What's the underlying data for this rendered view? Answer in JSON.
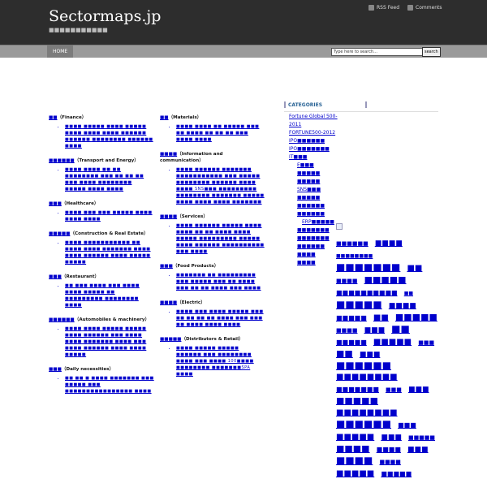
{
  "header": {
    "site_title": "Sectormaps.jp",
    "site_description": "■■■■■■■■■■■",
    "rss_label": "RSS Feed",
    "comments_label": "Comments",
    "rss_icon": "rss-icon",
    "comments_icon": "comment-feed-icon"
  },
  "nav": {
    "home_label": "HOME",
    "search_placeholder": "Type here to search...",
    "search_button": "search"
  },
  "categories_left": [
    {
      "title_link": "■■",
      "title": "Finance",
      "items": [
        "■■■■ ■■■■■ ■■■■ ■■■■■ ■■■■ ■■■■ ■■■■ ■■■■■■ ■■■■■■ ■■■■■■■■ ■■■■■■ ■■■■"
      ]
    },
    {
      "title_link": "■■■■■■",
      "title": "Transport and Energy",
      "items": [
        "■■■■ ■■■■ ■■ ■■ ■■■■■■■■ ■■■ ■■ ■■ ■■ ■■■ ■■■■ ■■■■■■■■ ■■■■■ ■■■■ ■■■■"
      ]
    },
    {
      "title_link": "■■■",
      "title": "Healthcare",
      "items": [
        "■■■■ ■■■ ■■■ ■■■■■ ■■■■ ■■■■ ■■■■"
      ]
    },
    {
      "title_link": "■■■■■",
      "title": "Construction & Real Estate",
      "items": [
        "■■■■ ■■■■■■■■■■■ ■■ ■■■■ ■■■■ ■■■■■■■ ■■■■ ■■■■ ■■■■■■ ■■■■ ■■■■■ ■■■■■"
      ]
    },
    {
      "title_link": "■■■",
      "title": "Restaurant",
      "items": [
        "■■ ■■■ ■■■■ ■■■ ■■■■ ■■■■ ■■■■■ ■■ ■■■■■■■■■ ■■■■■■■■ ■■■■"
      ]
    },
    {
      "title_link": "■■■■■■",
      "title": "Automobiles & machinery",
      "items": [
        "■■■■ ■■■■ ■■■■■ ■■■■■ ■■■■ ■■■■■■ ■■■ ■■■■ ■■■■ ■■■■■■■ ■■■■ ■■■ ■■■■ ■■■■■■ ■■■■ ■■■■ ■■■■■"
      ]
    },
    {
      "title_link": "■■■",
      "title": "Daily necessities",
      "items": [
        "■■ ■■ ■ ■■■■ ■■■■■■■ ■■■ ■■■■■ ■■■ ■■■■■■■■■■■■■■■■ ■■■■"
      ]
    }
  ],
  "categories_right": [
    {
      "title_link": "■■",
      "title": "Materials",
      "items": [
        "■■■■ ■■■■ ■■ ■■■■■ ■■■ ■■ ■■■■ ■■ ■■ ■■ ■■■ ■■■■ ■■■■"
      ]
    },
    {
      "title_link": "■■■■",
      "title": "Information and communication",
      "items": [
        "■■■■ ■■■■■■ ■■■■■■■ ■■■■■■■■■■■ ■■■ ■■■■■ ■■■■■■■■ ■■■■■■ ■■■■ ■■■■ SNS■■■ ■■■■■■■■■ ■■■■■■■■ ■■■■■■■ ■■■■■ ■■■■ ■■■■ ■■■■ ■■■■■■■"
      ]
    },
    {
      "title_link": "■■■■",
      "title": "Services",
      "items": [
        "■■■■ ■■■■■■ ■■■■■ ■■■■ ■■■■ ■■ ■■ ■■■■ ■■■■ ■■■■■ ■■■■■■■■■ ■■■■■ ■■■■ ■■■■■■ ■■■■■■■■■■ ■■■ ■■■■"
      ]
    },
    {
      "title_link": "■■■",
      "title": "Food Products",
      "items": [
        "■■■■■■■ ■■ ■■■■■■■■■ ■■■ ■■■■■ ■■■ ■■ ■■■■ ■■■ ■■ ■■ ■■■■ ■■■ ■■■■"
      ]
    },
    {
      "title_link": "■■■■",
      "title": "Electric",
      "items": [
        "■■■■ ■■■ ■■■■ ■■■■■ ■■■ ■■ ■■ ■■ ■■ ■■■■ ■■■ ■■■ ■■ ■■■■ ■■■■ ■■■■"
      ]
    },
    {
      "title_link": "■■■■■",
      "title": "Distributors & Retail",
      "items": [
        "■■■■ ■■■■■ ■■■■■ ■■■■■■ ■■■ ■■■■■■■■ ■■■■ ■■■ ■■■■ 100■■■■ ■■■■■■■■ ■■■■■■■SPA ■■■■"
      ]
    }
  ],
  "sidebar": {
    "categories_title": "CATEGORIES",
    "items": [
      {
        "level": 1,
        "label": "Fortune Global 500-2011"
      },
      {
        "level": 1,
        "label": "FORTUNE500-2012"
      },
      {
        "level": 1,
        "label": "IPO■■■■■■"
      },
      {
        "level": 1,
        "label": "IPO■■■■■■■"
      },
      {
        "level": 1,
        "label": "IT■■■"
      },
      {
        "level": 2,
        "label": "E■■■"
      },
      {
        "level": 2,
        "label": "■■■■■"
      },
      {
        "level": 2,
        "label": "■■■■■"
      },
      {
        "level": 2,
        "label": "SNS■■■"
      },
      {
        "level": 2,
        "label": "■■■■■"
      },
      {
        "level": 2,
        "label": "■■■■■■"
      },
      {
        "level": 2,
        "label": "■■■■■■"
      },
      {
        "level": 3,
        "label": "ERP■■■■■"
      },
      {
        "level": 2,
        "label": "■■■■■■■"
      },
      {
        "level": 2,
        "label": "■■■■■■■"
      },
      {
        "level": 2,
        "label": "■■■■■■"
      },
      {
        "level": 2,
        "label": "■■■■"
      },
      {
        "level": 2,
        "label": "■■■■"
      }
    ]
  },
  "tag_cloud": [
    "■■■■■■",
    "■■■■",
    "■■■■■■■■",
    "■■■■■■■",
    "■■",
    "■■■■",
    "■■■■■",
    "■■■■■■■■■■",
    "■■",
    "■■■■■",
    "■■■■",
    "■■■■■",
    "■■",
    "■■■■■",
    "■■■■",
    "■■■",
    "■■",
    "■■■■■",
    "■■■■■",
    "■■■",
    "■■",
    "■■■",
    "■■■■■■",
    "■■■■■■■■",
    "■■■■■■■",
    "■■■",
    "■■■",
    "■■■■■",
    "■■■■■■■■",
    "■■■■■■",
    "■■■",
    "■■■■■",
    "■■■",
    "■■■■■",
    "■■■■",
    "■■■■",
    "■■■",
    "■■■■",
    "■■■■",
    "■■■■■",
    "■■■■■"
  ]
}
